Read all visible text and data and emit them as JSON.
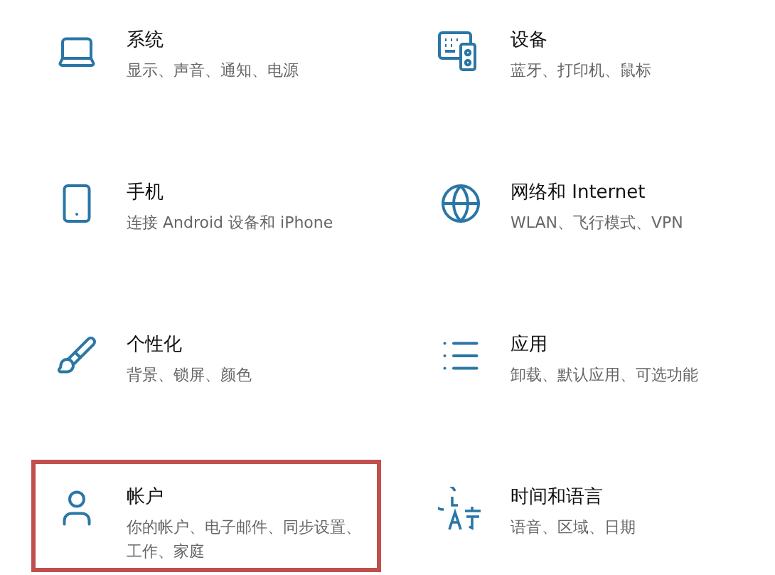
{
  "settings_tiles": [
    {
      "kind": "system",
      "title": "系统",
      "subtitle": "显示、声音、通知、电源",
      "highlighted": false
    },
    {
      "kind": "devices",
      "title": "设备",
      "subtitle": "蓝牙、打印机、鼠标",
      "highlighted": false
    },
    {
      "kind": "phone",
      "title": "手机",
      "subtitle": "连接 Android 设备和 iPhone",
      "highlighted": false
    },
    {
      "kind": "network",
      "title": "网络和 Internet",
      "subtitle": "WLAN、飞行模式、VPN",
      "highlighted": false
    },
    {
      "kind": "personalization",
      "title": "个性化",
      "subtitle": "背景、锁屏、颜色",
      "highlighted": false
    },
    {
      "kind": "apps",
      "title": "应用",
      "subtitle": "卸载、默认应用、可选功能",
      "highlighted": false
    },
    {
      "kind": "accounts",
      "title": "帐户",
      "subtitle": "你的帐户、电子邮件、同步设置、工作、家庭",
      "highlighted": true
    },
    {
      "kind": "time",
      "title": "时间和语言",
      "subtitle": "语音、区域、日期",
      "highlighted": false
    }
  ]
}
